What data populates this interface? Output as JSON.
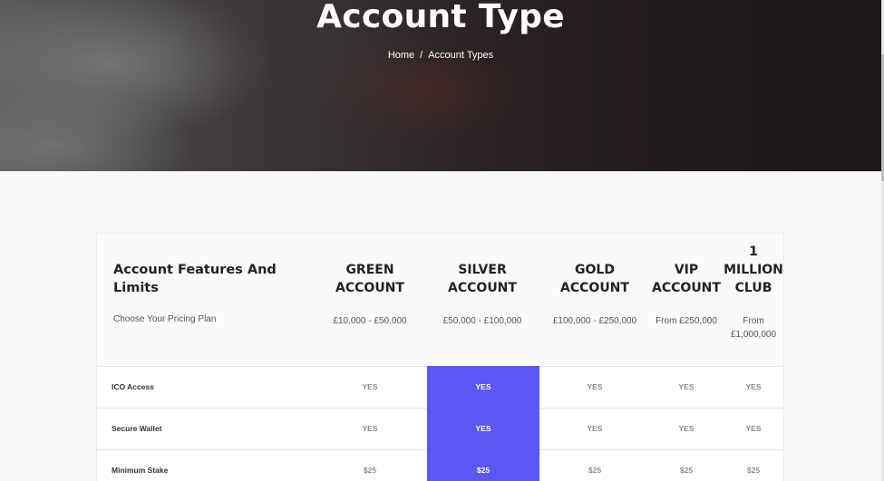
{
  "hero": {
    "title": "Account Type",
    "breadcrumb": {
      "home": "Home",
      "separator": "/",
      "current": "Account Types"
    }
  },
  "table": {
    "features_title": "Account Features And Limits",
    "features_subtitle": "Choose Your Pricing Plan",
    "highlight_color": "#5b57f2",
    "plans": [
      {
        "name": "GREEN ACCOUNT",
        "price": "£10,000 - £50,000"
      },
      {
        "name": "SILVER ACCOUNT",
        "price": "£50,000 - £100,000"
      },
      {
        "name": "GOLD ACCOUNT",
        "price": "£100,000 - £250,000"
      },
      {
        "name": "VIP ACCOUNT",
        "price": "From £250,000"
      },
      {
        "name": "1 MILLION CLUB",
        "price": "From £1,000,000"
      }
    ],
    "rows": [
      {
        "label": "ICO Access",
        "values": [
          "YES",
          "YES",
          "YES",
          "YES",
          "YES"
        ]
      },
      {
        "label": "Secure Wallet",
        "values": [
          "YES",
          "YES",
          "YES",
          "YES",
          "YES"
        ]
      },
      {
        "label": "Minimum Stake",
        "values": [
          "$25",
          "$25",
          "$25",
          "$25",
          "$25"
        ]
      }
    ]
  }
}
